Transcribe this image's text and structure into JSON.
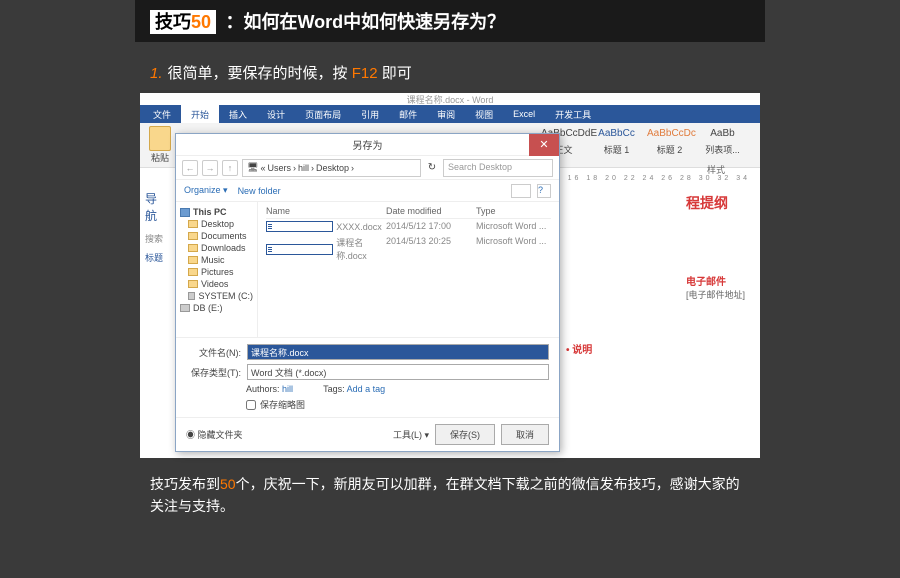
{
  "title": {
    "prefix": "技巧",
    "num": "50",
    "text": "：如何在Word中如何快速另存为？"
  },
  "subtitle": {
    "num": "1.",
    "t1": "很简单，要保存的时候，按 ",
    "key": "F12",
    "t2": " 即可"
  },
  "word": {
    "doctitle": "课程名称.docx - Word",
    "tabs": {
      "file": "文件",
      "home": "开始",
      "insert": "插入",
      "design": "设计",
      "layout": "页面布局",
      "ref": "引用",
      "mail": "邮件",
      "review": "审阅",
      "view": "视图",
      "excel": "Excel",
      "dev": "开发工具"
    },
    "paste": "粘贴",
    "styles": {
      "s1": "AaBbCcDdE",
      "s2": "AaBbCc",
      "s3": "AaBbCcDc",
      "s4": "AaBb",
      "l1": "正文",
      "l2": "标题 1",
      "l3": "标题 2",
      "l4": "列表项...",
      "group": "样式"
    },
    "ruler": "16  18  20  22  24  26  28  30  32  34"
  },
  "nav": {
    "title": "导航",
    "search": "搜索",
    "tab": "标题"
  },
  "dialog": {
    "title": "另存为",
    "path": {
      "users": "Users",
      "hill": "hill",
      "desktop": "Desktop"
    },
    "searchPlaceholder": "Search Desktop",
    "organize": "Organize",
    "newfolder": "New folder",
    "side": {
      "pc": "This PC",
      "desktop": "Desktop",
      "documents": "Documents",
      "downloads": "Downloads",
      "music": "Music",
      "pictures": "Pictures",
      "videos": "Videos",
      "system": "SYSTEM (C:)",
      "db": "DB (E:)"
    },
    "cols": {
      "name": "Name",
      "date": "Date modified",
      "type": "Type"
    },
    "files": [
      {
        "name": "XXXX.docx",
        "date": "2014/5/12 17:00",
        "type": "Microsoft Word ..."
      },
      {
        "name": "课程名称.docx",
        "date": "2014/5/13 20:25",
        "type": "Microsoft Word ..."
      }
    ],
    "fnLabel": "文件名(N):",
    "fnValue": "课程名称.docx",
    "ftLabel": "保存类型(T):",
    "ftValue": "Word 文档 (*.docx)",
    "authors": "Authors:",
    "authorVal": "hill",
    "tags": "Tags:",
    "tagVal": "Add a tag",
    "thumb": "保存缩略图",
    "hide": "隐藏文件夹",
    "tools": "工具(L)",
    "save": "保存(S)",
    "cancel": "取消"
  },
  "docbg": {
    "outline": "程提纲",
    "email": "电子邮件",
    "emailaddr": "[电子邮件地址]",
    "note": "说明"
  },
  "footer": {
    "t1": "技巧发布到",
    "num": "50",
    "t2": "个，庆祝一下，新朋友可以加群，在群文档下载之前的微信发布技巧，感谢大家的关注与支持。"
  }
}
